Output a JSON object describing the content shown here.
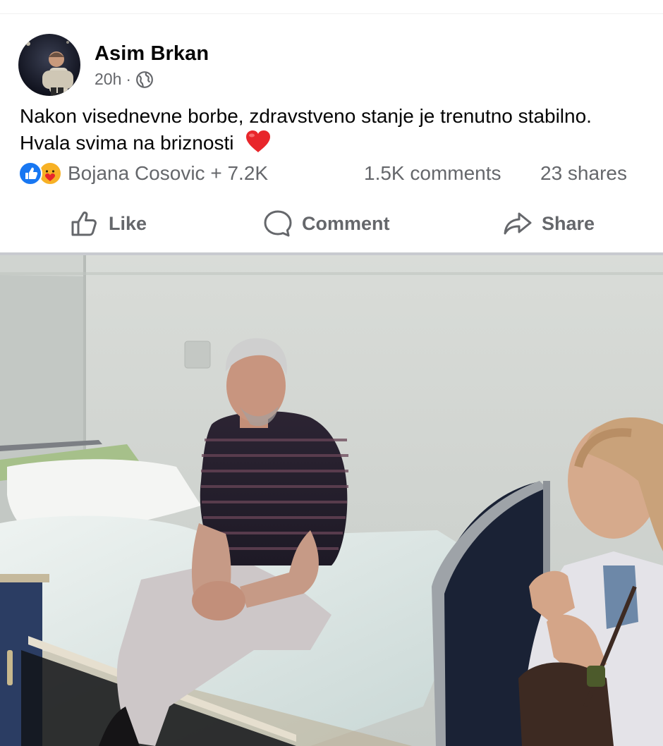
{
  "post": {
    "author": "Asim Brkan",
    "time": "20h",
    "separator": "·",
    "privacy_icon": "globe-icon",
    "text": "Nakon visednevne borbe, zdravstveno stanje je trenutno stabilno. Hvala svima na briznosti",
    "emoji": "red-heart"
  },
  "stats": {
    "reaction_icons": [
      "like-reaction-icon",
      "care-reaction-icon"
    ],
    "reacted_by": "Bojana Cosovic + 7.2K",
    "comments": "1.5K comments",
    "shares": "23 shares"
  },
  "actions": {
    "like": "Like",
    "comment": "Comment",
    "share": "Share"
  },
  "colors": {
    "text": "#050505",
    "secondary": "#65676b",
    "like_blue": "#1877f2",
    "care_yellow": "#f7b125",
    "heart_red": "#e8262b"
  }
}
